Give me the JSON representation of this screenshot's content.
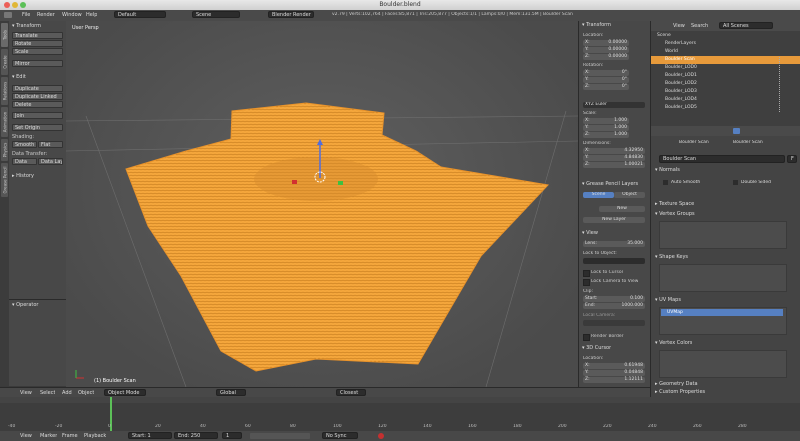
{
  "window": {
    "title": "Boulder.blend"
  },
  "info": {
    "menus": [
      "File",
      "Render",
      "Window",
      "Help"
    ],
    "layout": "Default",
    "scene": "Scene",
    "engine": "Blender Render",
    "stats": "v2.79 | Verts:102,764 | Faces:85,871 | Tris:205,877 | Objects:1/1 | Lamps:0/0 | Mem:131.5M | Boulder Scan"
  },
  "tabs": [
    "Tools",
    "Create",
    "Relations",
    "Animation",
    "Physics",
    "Grease Pencil"
  ],
  "tools": {
    "transform_header": "Transform",
    "transform": [
      "Translate",
      "Rotate",
      "Scale",
      "Mirror"
    ],
    "edit_header": "Edit",
    "edit": [
      "Duplicate",
      "Duplicate Linked",
      "Delete",
      "Join"
    ],
    "set_origin": "Set Origin",
    "shading": "Shading:",
    "smooth": "Smooth",
    "flat": "Flat",
    "data_transfer": "Data Transfer:",
    "data": "Data",
    "data_layo": "Data Layo",
    "history": "History",
    "operator": "Operator"
  },
  "viewport": {
    "view_name": "User Persp",
    "object_label": "(1) Boulder Scan"
  },
  "npanel": {
    "transform": "Transform",
    "location": "Location:",
    "loc": [
      {
        "a": "X:",
        "v": "0.00000"
      },
      {
        "a": "Y:",
        "v": "0.00000"
      },
      {
        "a": "Z:",
        "v": "0.00000"
      }
    ],
    "rotation": "Rotation:",
    "rot": [
      {
        "a": "X:",
        "v": "0°"
      },
      {
        "a": "Y:",
        "v": "0°"
      },
      {
        "a": "Z:",
        "v": "0°"
      }
    ],
    "rot_mode": "XYZ Euler",
    "scale": "Scale:",
    "scl": [
      {
        "a": "X:",
        "v": "1.000"
      },
      {
        "a": "Y:",
        "v": "1.000"
      },
      {
        "a": "Z:",
        "v": "1.000"
      }
    ],
    "dimensions": "Dimensions:",
    "dim": [
      {
        "a": "X:",
        "v": "4.32950"
      },
      {
        "a": "Y:",
        "v": "4.84830"
      },
      {
        "a": "Z:",
        "v": "1.00021"
      }
    ],
    "grease": "Grease Pencil Layers",
    "scene_btn": "Scene",
    "object_btn": "Object",
    "new_btn": "New",
    "new_layer": "New Layer",
    "view": "View",
    "lens": "Lens:",
    "lens_v": "35.000",
    "lock_object": "Lock to Object:",
    "lock_cursor": "Lock to Cursor",
    "lock_camera": "Lock Camera to View",
    "clip": "Clip:",
    "start": "Start:",
    "start_v": "0.100",
    "end": "End:",
    "end_v": "1000.000",
    "local_camera": "Local Camera:",
    "render_border": "Render Border",
    "cursor": "3D Cursor",
    "cursor_loc": "Location:",
    "cursor_x": "0.61948",
    "cursor_y": "0.04848",
    "cursor_z": "1.12111"
  },
  "outliner": {
    "view": "View",
    "search": "Search",
    "scene_filter": "All Scenes",
    "items": [
      "Scene",
      "RenderLayers",
      "World",
      "Boulder Scan",
      "Boulder_LOD0",
      "Boulder_LOD1",
      "Boulder_LOD2",
      "Boulder_LOD3",
      "Boulder_LOD4",
      "Boulder_LOD5"
    ]
  },
  "props": {
    "object": "Boulder Scan",
    "object2": "Boulder Scan",
    "mesh_name": "Boulder Scan",
    "f_btn": "F",
    "normals": "Normals",
    "auto_smooth": "Auto Smooth",
    "double_sided": "Double Sided",
    "texture_space": "Texture Space",
    "vertex_groups": "Vertex Groups",
    "shape_keys": "Shape Keys",
    "uv_maps": "UV Maps",
    "uv_name": "UVMap",
    "vertex_colors": "Vertex Colors",
    "geometry": "Geometry Data",
    "custom": "Custom Properties"
  },
  "tl": {
    "view": "View",
    "select": "Select",
    "add": "Add",
    "object": "Object",
    "mode": "Object Mode",
    "orient": "Global",
    "layer": "Closest",
    "ticks": [
      "-40",
      "-20",
      "0",
      "20",
      "40",
      "60",
      "80",
      "100",
      "120",
      "140",
      "160",
      "180",
      "200",
      "220",
      "240",
      "260",
      "280"
    ],
    "menus": [
      "View",
      "Marker",
      "Frame",
      "Playback"
    ],
    "start": "Start:",
    "start_v": "1",
    "end": "End:",
    "end_v": "250",
    "frame": "1",
    "sync": "No Sync"
  },
  "colors": {
    "mesh": "#f5a73c",
    "panel": "#484848",
    "accent": "#5680c2"
  }
}
